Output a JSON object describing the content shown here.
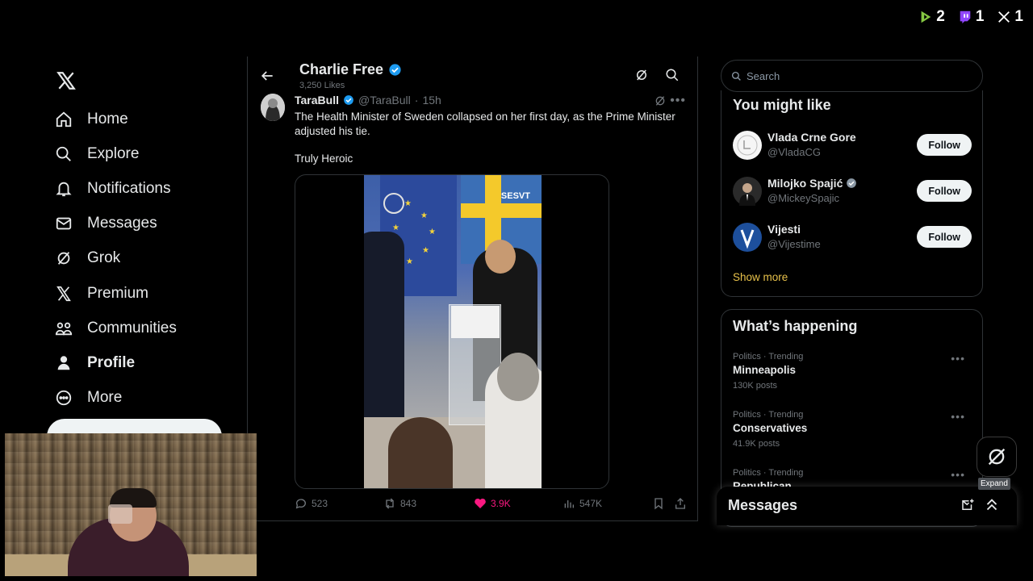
{
  "overlay": {
    "counts": [
      {
        "icon": "rumble-icon",
        "value": "2",
        "color": "#85c742"
      },
      {
        "icon": "twitch-icon",
        "value": "1",
        "color": "#9146ff"
      },
      {
        "icon": "x-icon",
        "value": "1",
        "color": "#ffffff"
      }
    ]
  },
  "nav": {
    "items": [
      {
        "label": "Home",
        "icon": "home-icon"
      },
      {
        "label": "Explore",
        "icon": "search-icon"
      },
      {
        "label": "Notifications",
        "icon": "bell-icon"
      },
      {
        "label": "Messages",
        "icon": "mail-icon"
      },
      {
        "label": "Grok",
        "icon": "grok-icon"
      },
      {
        "label": "Premium",
        "icon": "x-icon"
      },
      {
        "label": "Communities",
        "icon": "people-icon"
      },
      {
        "label": "Profile",
        "icon": "person-icon",
        "active": true
      },
      {
        "label": "More",
        "icon": "more-circle-icon"
      }
    ]
  },
  "header": {
    "title": "Charlie Free",
    "subtitle": "3,250 Likes"
  },
  "tweet": {
    "name": "TaraBull",
    "handle": "@TaraBull",
    "dot": "·",
    "time": "15h",
    "text": "The Health Minister of Sweden collapsed on her first day, as the Prime Minister adjusted his tie.",
    "text2": "Truly Heroic",
    "media_watermark": "SESVT",
    "replies": "523",
    "reposts": "843",
    "likes": "3.9K",
    "views": "547K"
  },
  "search": {
    "placeholder": "Search"
  },
  "who_to_follow": {
    "title": "You might like",
    "accounts": [
      {
        "name": "Vlada Crne Gore",
        "handle": "@VladaCG",
        "verified": false,
        "follow_label": "Follow"
      },
      {
        "name": "Milojko Spajić",
        "handle": "@MickeySpajic",
        "verified": true,
        "follow_label": "Follow"
      },
      {
        "name": "Vijesti",
        "handle": "@Vijestime",
        "verified": false,
        "follow_label": "Follow"
      }
    ],
    "show_more": "Show more"
  },
  "trending": {
    "title": "What’s happening",
    "items": [
      {
        "meta": "Politics · Trending",
        "name": "Minneapolis",
        "count": "130K posts"
      },
      {
        "meta": "Politics · Trending",
        "name": "Conservatives",
        "count": "41.9K posts"
      },
      {
        "meta": "Politics · Trending",
        "name": "Republican",
        "count": ""
      }
    ]
  },
  "messages_drawer": {
    "title": "Messages",
    "tooltip": "Expand"
  },
  "colors": {
    "accent_link": "#e7c14a",
    "like": "#f91880",
    "verified": "#1d9bf0"
  }
}
